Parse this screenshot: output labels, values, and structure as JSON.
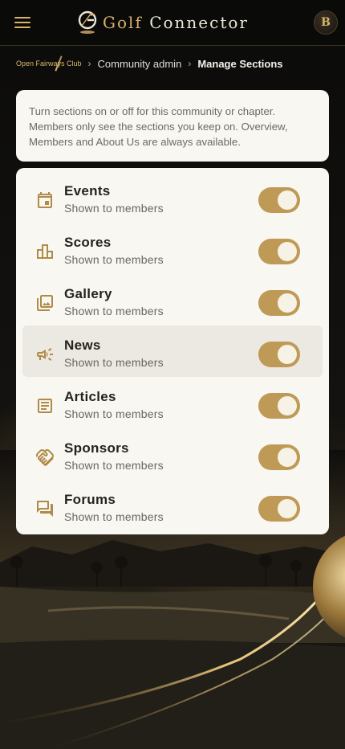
{
  "app": {
    "brand_first": "Golf",
    "brand_second": "Connector",
    "user_initial": "B"
  },
  "breadcrumb": {
    "club": "Open Fairways Club",
    "separator": "›",
    "admin": "Community admin",
    "current": "Manage Sections"
  },
  "info": {
    "text": "Turn sections on or off for this community or chapter. Members only see the sections you keep on. Overview, Members and About Us are always available."
  },
  "sections": [
    {
      "icon": "calendar-icon",
      "title": "Events",
      "subtitle": "Shown to members",
      "enabled": true
    },
    {
      "icon": "leaderboard-icon",
      "title": "Scores",
      "subtitle": "Shown to members",
      "enabled": true
    },
    {
      "icon": "photo-library-icon",
      "title": "Gallery",
      "subtitle": "Shown to members",
      "enabled": true
    },
    {
      "icon": "megaphone-icon",
      "title": "News",
      "subtitle": "Shown to members",
      "enabled": true
    },
    {
      "icon": "article-icon",
      "title": "Articles",
      "subtitle": "Shown to members",
      "enabled": true
    },
    {
      "icon": "handshake-icon",
      "title": "Sponsors",
      "subtitle": "Shown to members",
      "enabled": true
    },
    {
      "icon": "forum-icon",
      "title": "Forums",
      "subtitle": "Shown to members",
      "enabled": true
    }
  ],
  "colors": {
    "accent": "#bf9a56",
    "icon": "#b08a48",
    "card": "#f9f7f1",
    "topbar": "#0a0a09"
  }
}
